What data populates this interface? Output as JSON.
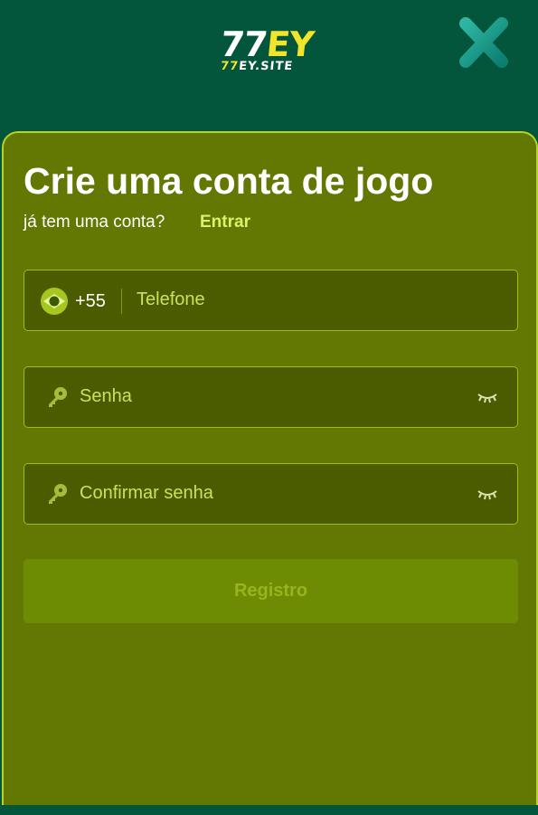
{
  "header": {
    "logo": {
      "main_white": "77",
      "main_yellow": "EY",
      "sub_yellow": "77",
      "sub_white": "EY.SITE"
    },
    "close_icon": "close-x-icon"
  },
  "form": {
    "title": "Crie uma conta de jogo",
    "have_account": "já tem uma conta?",
    "login_link": "Entrar",
    "phone": {
      "country_code": "+55",
      "placeholder": "Telefone",
      "value": "",
      "flag_icon": "brazil-flag-icon"
    },
    "password": {
      "placeholder": "Senha",
      "value": "",
      "icon": "key-icon",
      "toggle_icon": "eye-closed-icon"
    },
    "confirm_password": {
      "placeholder": "Confirmar senha",
      "value": "",
      "icon": "key-icon",
      "toggle_icon": "eye-closed-icon"
    },
    "submit_label": "Registro"
  },
  "colors": {
    "header_bg": "#03563c",
    "panel_bg": "#637703",
    "panel_border": "#b7d41a",
    "field_bg": "#4a5b00",
    "accent_link": "#d8f26a",
    "button_bg": "#6e8c03",
    "logo_yellow": "#f2e42a"
  }
}
